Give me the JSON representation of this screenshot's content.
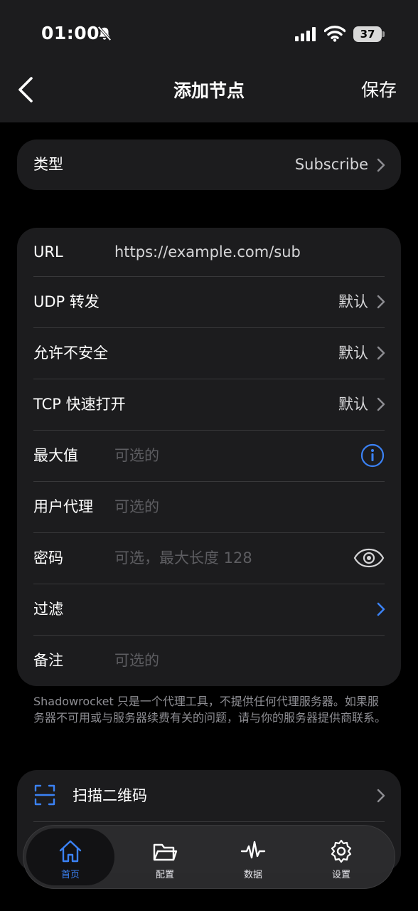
{
  "status_bar": {
    "time": "01:00",
    "battery": "37"
  },
  "nav": {
    "title": "添加节点",
    "save_label": "保存"
  },
  "type_card": {
    "label": "类型",
    "value": "Subscribe"
  },
  "fields": {
    "url": {
      "label": "URL",
      "value": "https://example.com/sub"
    },
    "udp": {
      "label": "UDP 转发",
      "value": "默认"
    },
    "insecure": {
      "label": "允许不安全",
      "value": "默认"
    },
    "tfo": {
      "label": "TCP 快速打开",
      "value": "默认"
    },
    "max": {
      "label": "最大值",
      "placeholder": "可选的"
    },
    "user_agent": {
      "label": "用户代理",
      "placeholder": "可选的"
    },
    "password": {
      "label": "密码",
      "placeholder": "可选，最大长度 128"
    },
    "filter": {
      "label": "过滤"
    },
    "remark": {
      "label": "备注",
      "placeholder": "可选的"
    }
  },
  "disclaimer": "Shadowrocket 只是一个代理工具，不提供任何代理服务器。如果服务器不可用或与服务器续费有关的问题，请与你的服务器提供商联系。",
  "qr": {
    "label": "扫描二维码"
  },
  "tabs": [
    {
      "label": "首页",
      "icon": "home-icon",
      "active": true
    },
    {
      "label": "配置",
      "icon": "folder-icon",
      "active": false
    },
    {
      "label": "数据",
      "icon": "waveform-icon",
      "active": false
    },
    {
      "label": "设置",
      "icon": "gear-icon",
      "active": false
    }
  ],
  "colors": {
    "accent": "#3b82f6",
    "card": "#1c1c1e",
    "background": "#000000"
  }
}
